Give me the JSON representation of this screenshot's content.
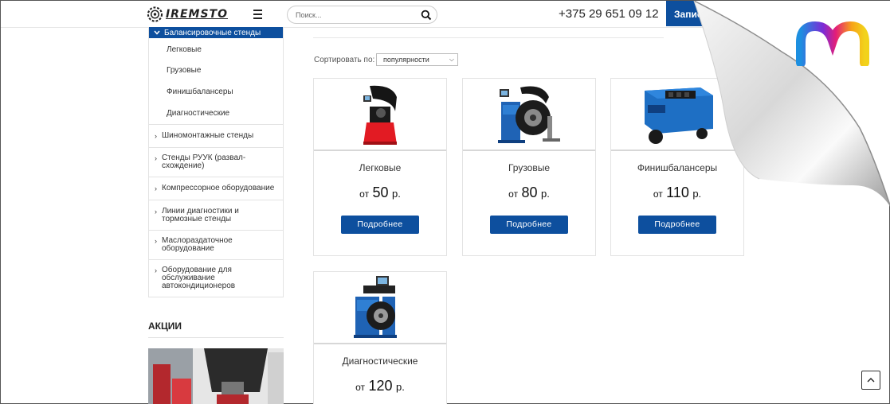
{
  "header": {
    "logo_text": "IREMSTO",
    "search_placeholder": "Поиск...",
    "phone": "+375 29 651 09 12",
    "signup_label": "Записаться"
  },
  "sidebar": {
    "active_category": "Балансировочные стенды",
    "subitems": [
      "Легковые",
      "Грузовые",
      "Финишбалансеры",
      "Диагностические"
    ],
    "categories": [
      "Шиномонтажные стенды",
      "Стенды РУУК (развал-схождение)",
      "Компрессорное оборудование",
      "Линии диагностики и тормозные стенды",
      "Маслораздаточное оборудование",
      "Оборудование для обслуживание автокондиционеров"
    ]
  },
  "promos": {
    "title": "АКЦИИ"
  },
  "sort": {
    "label": "Сортировать по:",
    "selected": "популярности"
  },
  "products": [
    {
      "name": "Легковые",
      "from": "от",
      "price": "50",
      "currency": "р.",
      "button": "Подробнее"
    },
    {
      "name": "Грузовые",
      "from": "от",
      "price": "80",
      "currency": "р.",
      "button": "Подробнее"
    },
    {
      "name": "Финишбалансеры",
      "from": "от",
      "price": "110",
      "currency": "р.",
      "button": "Подробнее"
    },
    {
      "name": "Диагностические",
      "from": "от",
      "price": "120",
      "currency": "р.",
      "button": "Подробнее"
    }
  ],
  "colors": {
    "accent": "#0d4f9e",
    "border": "#e3e3e3"
  },
  "icons": {
    "menu": "hamburger-icon",
    "search": "search-icon",
    "scroll_top": "chevron-up-icon",
    "chevron": "chevron-right-icon",
    "active_chevron": "chevron-down-icon"
  }
}
